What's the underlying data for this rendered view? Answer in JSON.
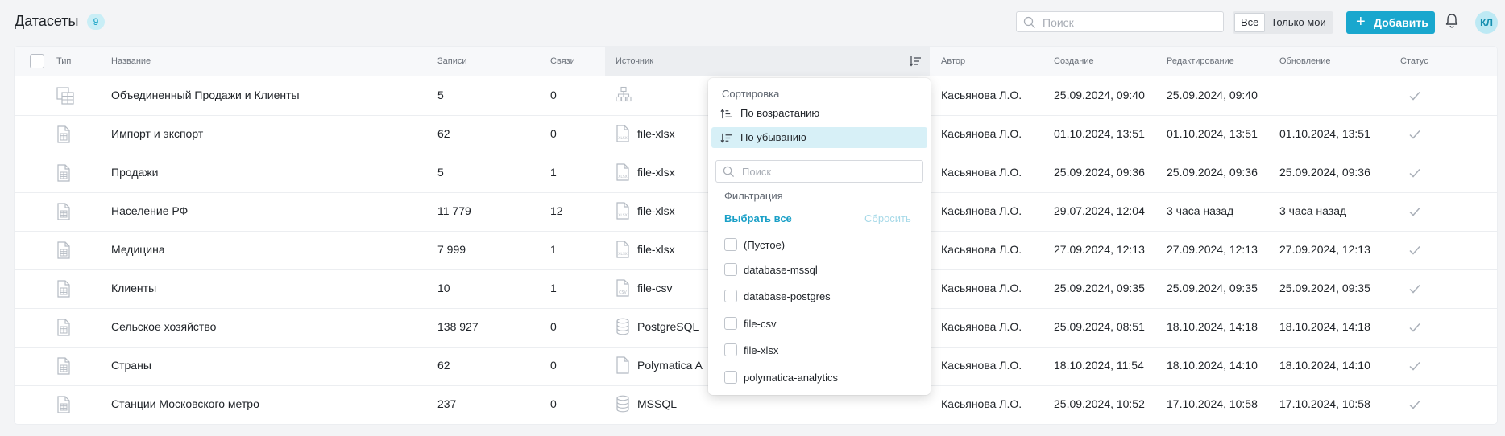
{
  "header": {
    "title": "Датасеты",
    "count": "9",
    "search_placeholder": "Поиск",
    "filter_all": "Все",
    "filter_mine": "Только мои",
    "add_label": "Добавить",
    "avatar_initials": "КЛ"
  },
  "table": {
    "columns": {
      "type": "Тип",
      "name": "Название",
      "records": "Записи",
      "links": "Связи",
      "source": "Источник",
      "author": "Автор",
      "created": "Создание",
      "edited": "Редактирование",
      "updated": "Обновление",
      "status": "Статус"
    },
    "rows": [
      {
        "type_icon": "joined-table-icon",
        "name": "Объединенный Продажи и Клиенты",
        "records": "5",
        "links": "0",
        "source_icon": "hierarchy-icon",
        "source": "",
        "author": "Касьянова Л.О.",
        "created": "25.09.2024, 09:40",
        "edited": "25.09.2024, 09:40",
        "updated": ""
      },
      {
        "type_icon": "file-table-icon",
        "name": "Импорт и экспорт",
        "records": "62",
        "links": "0",
        "source_icon": "xlsx-file-icon",
        "source": "file-xlsx",
        "author": "Касьянова Л.О.",
        "created": "01.10.2024, 13:51",
        "edited": "01.10.2024, 13:51",
        "updated": "01.10.2024, 13:51"
      },
      {
        "type_icon": "file-table-icon",
        "name": "Продажи",
        "records": "5",
        "links": "1",
        "source_icon": "xlsx-file-icon",
        "source": "file-xlsx",
        "author": "Касьянова Л.О.",
        "created": "25.09.2024, 09:36",
        "edited": "25.09.2024, 09:36",
        "updated": "25.09.2024, 09:36"
      },
      {
        "type_icon": "file-table-icon",
        "name": "Население РФ",
        "records": "11 779",
        "links": "12",
        "source_icon": "xlsx-file-icon",
        "source": "file-xlsx",
        "author": "Касьянова Л.О.",
        "created": "29.07.2024, 12:04",
        "edited": "3 часа назад",
        "updated": "3 часа назад"
      },
      {
        "type_icon": "file-table-icon",
        "name": "Медицина",
        "records": "7 999",
        "links": "1",
        "source_icon": "xlsx-file-icon",
        "source": "file-xlsx",
        "author": "Касьянова Л.О.",
        "created": "27.09.2024, 12:13",
        "edited": "27.09.2024, 12:13",
        "updated": "27.09.2024, 12:13"
      },
      {
        "type_icon": "file-table-icon",
        "name": "Клиенты",
        "records": "10",
        "links": "1",
        "source_icon": "csv-file-icon",
        "source": "file-csv",
        "author": "Касьянова Л.О.",
        "created": "25.09.2024, 09:35",
        "edited": "25.09.2024, 09:35",
        "updated": "25.09.2024, 09:35"
      },
      {
        "type_icon": "file-table-icon",
        "name": "Сельское хозяйство",
        "records": "138 927",
        "links": "0",
        "source_icon": "database-icon",
        "source": "PostgreSQL",
        "author": "Касьянова Л.О.",
        "created": "25.09.2024, 08:51",
        "edited": "18.10.2024, 14:18",
        "updated": "18.10.2024, 14:18"
      },
      {
        "type_icon": "file-table-icon",
        "name": "Страны",
        "records": "62",
        "links": "0",
        "source_icon": "document-icon",
        "source": "Polymatica A",
        "author": "Касьянова Л.О.",
        "created": "18.10.2024, 11:54",
        "edited": "18.10.2024, 14:10",
        "updated": "18.10.2024, 14:10"
      },
      {
        "type_icon": "file-table-icon",
        "name": "Станции Московского метро",
        "records": "237",
        "links": "0",
        "source_icon": "database-icon",
        "source": "MSSQL",
        "author": "Касьянова Л.О.",
        "created": "25.09.2024, 10:52",
        "edited": "17.10.2024, 10:58",
        "updated": "17.10.2024, 10:58"
      }
    ]
  },
  "dropdown": {
    "sort_title": "Сортировка",
    "asc": "По возрастанию",
    "desc": "По убыванию",
    "search_placeholder": "Поиск",
    "filter_title": "Фильтрация",
    "select_all": "Выбрать все",
    "reset": "Сбросить",
    "options": [
      "(Пустое)",
      "database-mssql",
      "database-postgres",
      "file-csv",
      "file-xlsx",
      "polymatica-analytics"
    ]
  },
  "colors": {
    "accent": "#19a7ce",
    "active_option": "#d7f0f7",
    "status_check": "#a9afb8"
  }
}
